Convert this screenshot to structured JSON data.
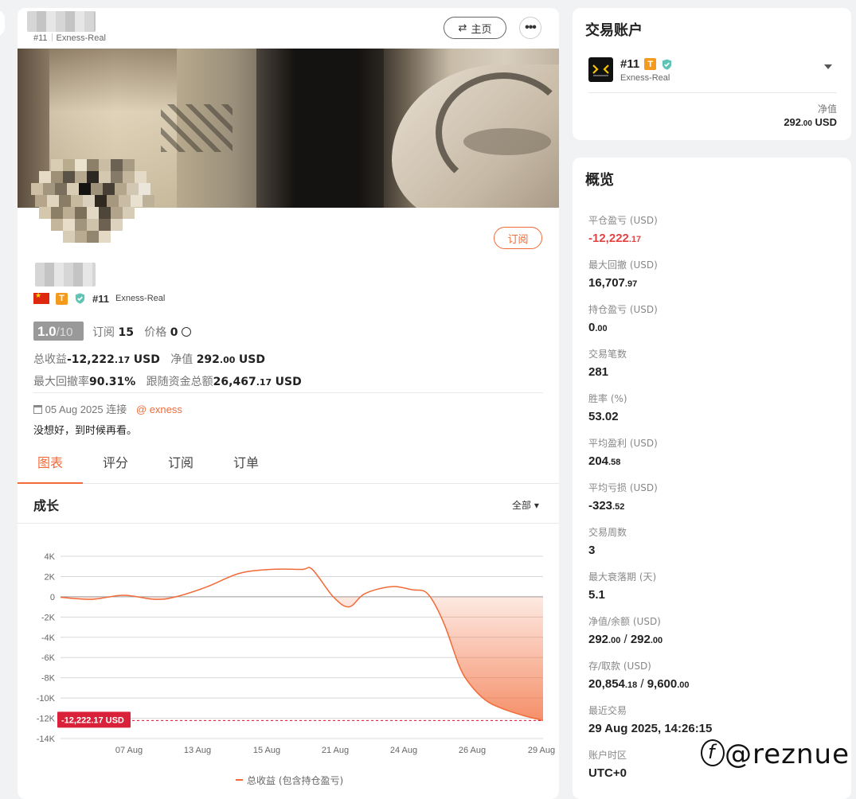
{
  "profile": {
    "account_id": "#11",
    "account_type": "Exness-Real",
    "home_button": "主页",
    "more_button": "•••",
    "subscribe_button": "订阅",
    "score_main": "1.0",
    "score_suffix": "/10",
    "subs_label": "订阅",
    "subs_value": "15",
    "price_label": "价格",
    "price_value": "0",
    "total_label": "总收益",
    "total_int": "-12,222",
    "total_dec": ".17",
    "total_unit": "USD",
    "equity_label": "净值",
    "equity_int": "292",
    "equity_dec": ".00",
    "equity_unit": "USD",
    "dd_label": "最大回撤率",
    "dd_value": "90.31%",
    "follow_label": "跟随资金总额",
    "follow_int": "26,467",
    "follow_dec": ".17",
    "follow_unit": "USD",
    "connected": "05 Aug 2025 连接",
    "broker": "exness",
    "description": "没想好，到时候再看。"
  },
  "tabs": [
    "图表",
    "评分",
    "订阅",
    "订单"
  ],
  "chart_header": {
    "title": "成长",
    "range": "全部"
  },
  "chart_data": {
    "type": "line",
    "y_ticks": [
      "4K",
      "2K",
      "0",
      "-2K",
      "-4K",
      "-6K",
      "-8K",
      "-10K",
      "-12K",
      "-14K"
    ],
    "ylim": [
      -14000,
      4000
    ],
    "x_ticks": [
      "07 Aug",
      "13 Aug",
      "15 Aug",
      "21 Aug",
      "24 Aug",
      "26 Aug",
      "29 Aug"
    ],
    "series": [
      {
        "name": "总收益 (包含持仓盈亏)",
        "color": "#f26a37",
        "points": [
          [
            0,
            -50
          ],
          [
            3,
            -250
          ],
          [
            6,
            150
          ],
          [
            9,
            -250
          ],
          [
            11,
            0
          ],
          [
            14,
            1000
          ],
          [
            17,
            2300
          ],
          [
            20,
            2700
          ],
          [
            23,
            2700
          ],
          [
            24,
            2700
          ],
          [
            26,
            0
          ],
          [
            27.5,
            -1000
          ],
          [
            29,
            300
          ],
          [
            31.5,
            1000
          ],
          [
            33.5,
            700
          ],
          [
            35,
            300
          ],
          [
            36.5,
            -2500
          ],
          [
            38,
            -6800
          ],
          [
            39,
            -8600
          ],
          [
            40.5,
            -10200
          ],
          [
            42,
            -11000
          ],
          [
            44,
            -11700
          ],
          [
            45.5,
            -12100
          ],
          [
            46,
            -12222
          ]
        ]
      }
    ],
    "last_value_label": "-12,222.17 USD"
  },
  "account_card": {
    "title": "交易账户",
    "account_id": "#11",
    "account_type": "Exness-Real",
    "equity_label": "净值",
    "equity_int": "292",
    "equity_dec": ".00",
    "equity_unit": "USD"
  },
  "overview": {
    "title": "概览",
    "items": [
      {
        "label": "平仓盈亏 (USD)",
        "int": "-12,222",
        "dec": ".17",
        "red": true
      },
      {
        "label": "最大回撤 (USD)",
        "int": "16,707",
        "dec": ".97"
      },
      {
        "label": "持仓盈亏 (USD)",
        "int": "0",
        "dec": ".00"
      },
      {
        "label": "交易笔数",
        "int": "281",
        "dec": ""
      },
      {
        "label": "胜率 (%)",
        "int": "53.02",
        "dec": ""
      },
      {
        "label": "平均盈利 (USD)",
        "int": "204",
        "dec": ".58"
      },
      {
        "label": "平均亏损 (USD)",
        "int": "-323",
        "dec": ".52"
      },
      {
        "label": "交易周数",
        "int": "3",
        "dec": ""
      },
      {
        "label": "最大衰落期 (天)",
        "int": "5.1",
        "dec": ""
      },
      {
        "label": "净值/余额 (USD)",
        "int": "292",
        "dec": ".00",
        "int2": "292",
        "dec2": ".00"
      },
      {
        "label": "存/取款 (USD)",
        "int": "20,854",
        "dec": ".18",
        "int2": "9,600",
        "dec2": ".00"
      },
      {
        "label": "最近交易",
        "int": "29 Aug 2025, 14:26:15",
        "dec": ""
      },
      {
        "label": "账户时区",
        "int": "UTC+0",
        "dec": ""
      }
    ]
  },
  "watermark": "@reznue"
}
